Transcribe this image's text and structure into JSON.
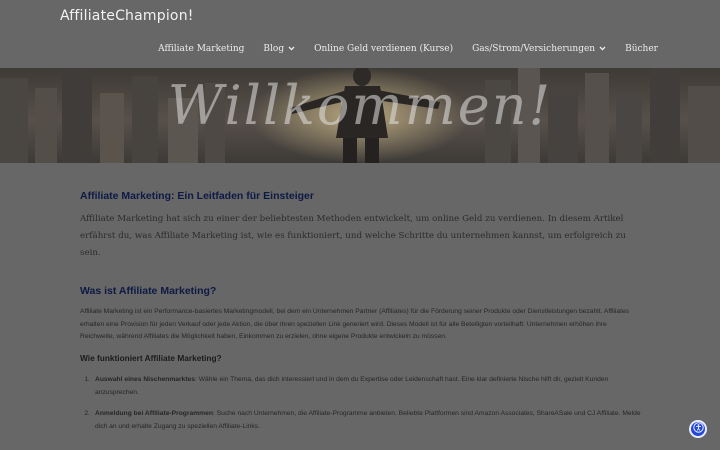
{
  "header": {
    "brand": "AffiliateChampion!",
    "nav": [
      {
        "label": "Affiliate Marketing",
        "has_dropdown": false
      },
      {
        "label": "Blog",
        "has_dropdown": true
      },
      {
        "label": "Online Geld verdienen (Kurse)",
        "has_dropdown": false
      },
      {
        "label": "Gas/Strom/Versicherungen",
        "has_dropdown": true
      },
      {
        "label": "Bücher",
        "has_dropdown": false
      }
    ]
  },
  "hero": {
    "text": "Willkommen!"
  },
  "article": {
    "title": "Affiliate Marketing: Ein Leitfaden für Einsteiger",
    "intro": "Affiliate Marketing hat sich zu einer der beliebtesten Methoden entwickelt, um online Geld zu verdienen. In diesem Artikel erfährst du, was Affiliate Marketing ist, wie es funktioniert, und welche Schritte du unternehmen kannst, um erfolgreich zu sein.",
    "section1_title": "Was ist Affiliate Marketing?",
    "section1_text": "Affiliate Marketing ist ein Performance-basiertes Marketingmodell, bei dem ein Unternehmen Partner (Affiliates) für die Förderung seiner Produkte oder Dienstleistungen bezahlt. Affiliates erhalten eine Provision für jeden Verkauf oder jede Aktion, die über ihren speziellen Link generiert wird. Dieses Modell ist für alle Beteiligten vorteilhaft: Unternehmen erhöhen ihre Reichweite, während Affiliates die Möglichkeit haben, Einkommen zu erzielen, ohne eigene Produkte entwickeln zu müssen.",
    "section2_title": "Wie funktioniert Affiliate Marketing?",
    "steps": [
      {
        "num": "1.",
        "bold": "Auswahl eines Nischenmarktes",
        "text": ": Wähle ein Thema, das dich interessiert und in dem du Expertise oder Leidenschaft hast. Eine klar definierte Nische hilft dir, gezielt Kunden anzusprechen."
      },
      {
        "num": "2.",
        "bold": "Anmeldung bei Affiliate-Programmen",
        "text": ": Suche nach Unternehmen, die Affiliate-Programme anbieten. Beliebte Plattformen sind Amazon Associates, ShareASale und CJ Affiliate. Melde dich an und erhalte Zugang zu speziellen Affiliate-Links."
      }
    ]
  },
  "colors": {
    "overlay": "#676767",
    "heading": "#0d1a44",
    "accessibility_button": "#2547d8"
  },
  "icons": {
    "dropdown": "chevron-down-icon",
    "accessibility": "accessibility-icon"
  }
}
